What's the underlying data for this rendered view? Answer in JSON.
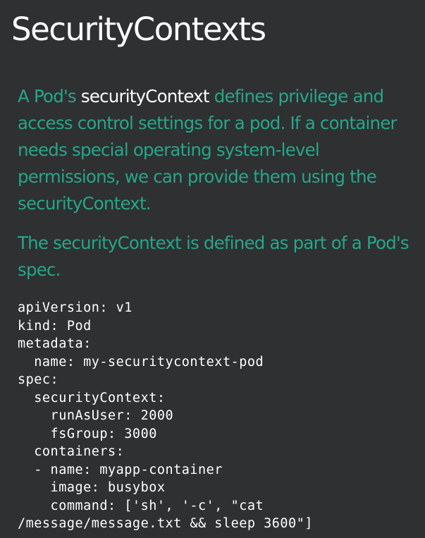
{
  "slide": {
    "title": "SecurityContexts",
    "paragraph1": {
      "before": "A Pod's ",
      "highlight": "securityContext",
      "after": " defines privilege and access control settings for a pod. If a container needs special operating system-level permissions, we can provide them using the securityContext."
    },
    "paragraph2": "The securityContext is defined as part of a Pod's spec.",
    "code_lines": [
      "apiVersion: v1",
      "kind: Pod",
      "metadata:",
      "  name: my-securitycontext-pod",
      "spec:",
      "  securityContext:",
      "    runAsUser: 2000",
      "    fsGroup: 3000",
      "  containers:",
      "  - name: myapp-container",
      "    image: busybox",
      "    command: ['sh', '-c', \"cat",
      "/message/message.txt && sleep 3600\"]"
    ]
  },
  "colors": {
    "background": "#2f3031",
    "accent_text": "#26a68b",
    "highlight_text": "#ffffff",
    "code_text": "#ffffff"
  }
}
